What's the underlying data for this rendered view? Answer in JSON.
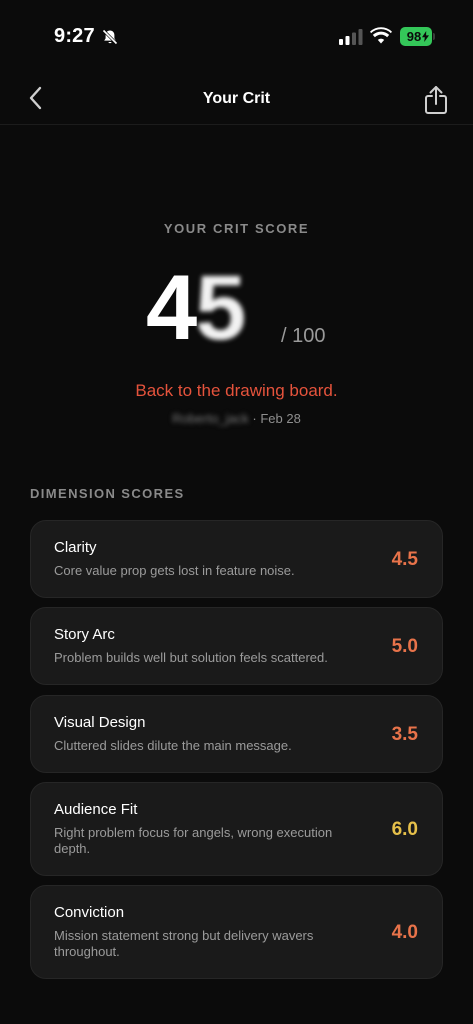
{
  "status": {
    "time": "9:27",
    "battery": "98"
  },
  "nav": {
    "title": "Your Crit"
  },
  "score": {
    "label": "YOUR CRIT SCORE",
    "value_first": "4",
    "value_second": "5",
    "max": "/ 100",
    "verdict": "Back to the drawing board.",
    "user": "Roberto_jack",
    "date": "· Feb 28"
  },
  "section": {
    "label": "DIMENSION SCORES"
  },
  "dimensions": [
    {
      "title": "Clarity",
      "desc": "Core value prop gets lost in feature noise.",
      "score": "4.5",
      "color": "#e8734a"
    },
    {
      "title": "Story Arc",
      "desc": "Problem builds well but solution feels scattered.",
      "score": "5.0",
      "color": "#e8734a"
    },
    {
      "title": "Visual Design",
      "desc": "Cluttered slides dilute the main message.",
      "score": "3.5",
      "color": "#e8734a"
    },
    {
      "title": "Audience Fit",
      "desc": "Right problem focus for angels, wrong execution depth.",
      "score": "6.0",
      "color": "#e6c04a"
    },
    {
      "title": "Conviction",
      "desc": "Mission statement strong but delivery wavers throughout.",
      "score": "4.0",
      "color": "#e8734a"
    }
  ],
  "colors": {
    "background": "#0b0b0b",
    "card": "#1a1a1a",
    "verdict": "#e5533c",
    "battery": "#34c759"
  },
  "icons": {
    "back": "chevron-left-icon",
    "share": "share-icon",
    "silent": "bell-slash-icon",
    "signal": "signal-icon",
    "wifi": "wifi-icon"
  }
}
